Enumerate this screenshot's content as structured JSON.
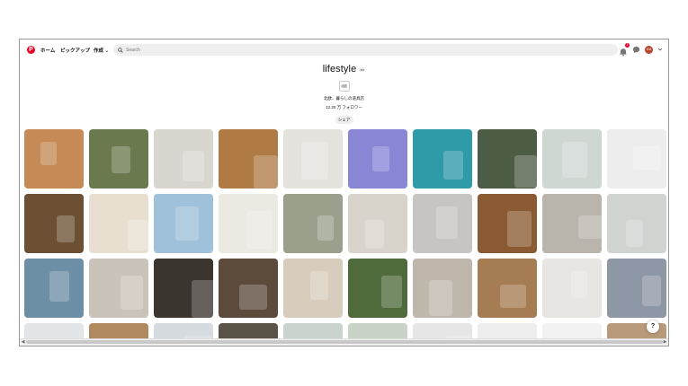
{
  "nav": {
    "logo_glyph": "P",
    "home": "ホーム",
    "pickup": "ピックアップ",
    "create": "作成",
    "create_chevron": "⌄"
  },
  "search": {
    "placeholder": "Search"
  },
  "header": {
    "notification_count": "1",
    "avatar_initials": "KM"
  },
  "board": {
    "title": "lifestyle",
    "more_glyph": "•••",
    "owner_logo": "北欧",
    "owner_name": "北欧、暮らしの道具店",
    "followers": "12.20 万 フォロワー",
    "share_label": "シェア"
  },
  "help_label": "?",
  "colors": {
    "brand": "#e60023",
    "search_bg": "#efefef"
  },
  "tiles": [
    "#c58a55",
    "#6b7a4e",
    "#d9d6d0",
    "#b07a44",
    "#e4e2dd",
    "#8a86d6",
    "#2f9aa8",
    "#4d5c45",
    "#cfd7d2",
    "#ededed",
    "#6b5034",
    "#e8dfd0",
    "#9fc1d9",
    "#ece8e2",
    "#9aa08c",
    "#d8d4cc",
    "#c7c5c3",
    "#8a5a33",
    "#b9b5ad",
    "#cfd4d1",
    "#6d8fa6",
    "#c9c3b9",
    "#3b3530",
    "#5c4a3a",
    "#d8cdbd",
    "#4f6b3c",
    "#bfb7ac",
    "#a67c52",
    "#e7e6e3",
    "#8e97a6",
    "#e3e6e8",
    "#b08a5e",
    "#d6dbe0",
    "#5a5448",
    "#cad3ce",
    "#c9d3c7",
    "#e6e6e6",
    "#eeeeee",
    "#f2f2f2",
    "#b89a7a"
  ]
}
